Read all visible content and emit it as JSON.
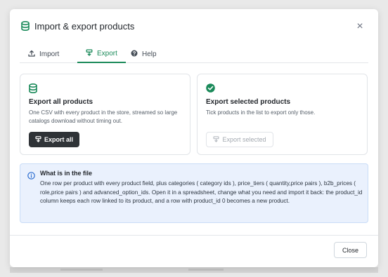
{
  "dialog": {
    "title": "Import & export products",
    "close_glyph": "×",
    "title_icon": "database-icon"
  },
  "tabs": [
    {
      "label": "Import",
      "icon": "upload-icon",
      "active": false
    },
    {
      "label": "Export",
      "icon": "download-icon",
      "active": true
    },
    {
      "label": "Help",
      "icon": "help-icon",
      "active": false
    }
  ],
  "export_all": {
    "title": "Export all products",
    "description": "One CSV with every product in the store, streamed so large catalogs download without timing out.",
    "button_label": "Export all",
    "icon": "database-icon"
  },
  "export_selected": {
    "title": "Export selected products",
    "description": "Tick products in the list to export only those.",
    "button_label": "Export selected",
    "button_disabled": true,
    "icon": "check-circle-icon"
  },
  "info": {
    "title": "What is in the file",
    "body": "One row per product with every product field, plus categories ( category ids ), price_tiers ( quantity,price pairs ), b2b_prices ( role,price pairs ) and advanced_option_ids. Open it in a spreadsheet, change what you need and import it back: the product_id column keeps each row linked to its product, and a row with product_id 0 becomes a new product.",
    "icon": "info-icon"
  },
  "footer": {
    "close_label": "Close"
  },
  "colors": {
    "accent": "#1b8a5a",
    "dark_button": "#2f3337",
    "info_bg": "#eaf1fd",
    "info_border": "#c9dcf7",
    "info_icon": "#2f6fd1"
  }
}
